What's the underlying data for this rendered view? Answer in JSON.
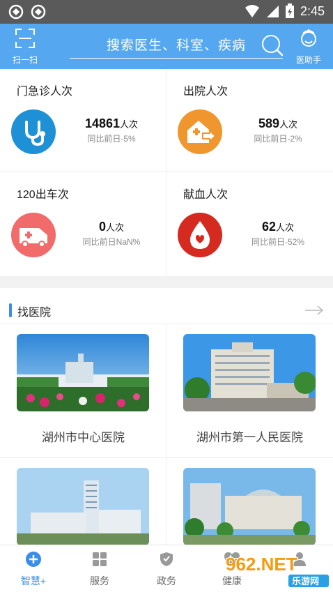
{
  "status_bar": {
    "time": "2:45"
  },
  "header": {
    "scan_label": "扫一扫",
    "search_placeholder": "搜索医生、科室、疾病",
    "helper_label": "医助手"
  },
  "stats": [
    {
      "title": "门急诊人次",
      "number": "14861",
      "unit": "人次",
      "compare": "同比前日-5%",
      "icon": "stethoscope-icon",
      "color": "#1e90d6"
    },
    {
      "title": "出院人次",
      "number": "589",
      "unit": "人次",
      "compare": "同比前日-2%",
      "icon": "hospital-exit-icon",
      "color": "#f0962e"
    },
    {
      "title": "120出车次",
      "number": "0",
      "unit": "人次",
      "compare": "同比前日NaN%",
      "icon": "ambulance-icon",
      "color": "#f26b6b"
    },
    {
      "title": "献血人次",
      "number": "62",
      "unit": "人次",
      "compare": "同比前日-52%",
      "icon": "blood-drop-icon",
      "color": "#d42a1f"
    }
  ],
  "hospitals": {
    "title": "找医院",
    "items": [
      {
        "name": "湖州市中心医院"
      },
      {
        "name": "湖州市第一人民医院"
      },
      {
        "name": ""
      },
      {
        "name": ""
      }
    ]
  },
  "bottom_nav": [
    {
      "label": "智慧+",
      "icon": "plus-circle-icon",
      "active": true
    },
    {
      "label": "服务",
      "icon": "grid-icon",
      "active": false
    },
    {
      "label": "政务",
      "icon": "shield-icon",
      "active": false
    },
    {
      "label": "健康",
      "icon": "heartbeat-icon",
      "active": false
    },
    {
      "label": "",
      "icon": "user-icon",
      "active": false
    }
  ],
  "watermark": {
    "text": "962.NET",
    "subtext": "乐游网"
  }
}
